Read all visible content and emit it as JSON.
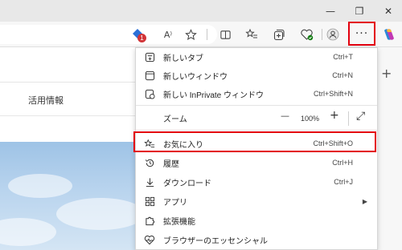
{
  "window": {
    "minimize_glyph": "—",
    "restore_glyph": "❐",
    "close_glyph": "✕"
  },
  "toolbar": {
    "read_aloud_glyph": "A⁾",
    "more_glyph": "···"
  },
  "page": {
    "nav_text": "活用情報"
  },
  "sidebar": {
    "add_glyph": "+"
  },
  "menu": {
    "new_tab": {
      "label": "新しいタブ",
      "shortcut": "Ctrl+T",
      "icon": "new-tab-icon"
    },
    "new_window": {
      "label": "新しいウィンドウ",
      "shortcut": "Ctrl+N",
      "icon": "new-window-icon"
    },
    "new_inprivate": {
      "label": "新しい InPrivate ウィンドウ",
      "shortcut": "Ctrl+Shift+N",
      "icon": "inprivate-icon"
    },
    "zoom": {
      "label": "ズーム",
      "value": "100%",
      "minus": "—",
      "plus": "+",
      "expand": "⤢"
    },
    "favorites": {
      "label": "お気に入り",
      "shortcut": "Ctrl+Shift+O",
      "icon": "favorites-icon"
    },
    "history": {
      "label": "履歴",
      "shortcut": "Ctrl+H",
      "icon": "history-icon"
    },
    "downloads": {
      "label": "ダウンロード",
      "shortcut": "Ctrl+J",
      "icon": "download-icon"
    },
    "apps": {
      "label": "アプリ",
      "arrow": "▶",
      "icon": "apps-icon"
    },
    "extensions": {
      "label": "拡張機能",
      "icon": "extensions-icon"
    },
    "browser_essentials": {
      "label": "ブラウザーのエッセンシャル",
      "icon": "heart-pulse-icon"
    }
  },
  "colors": {
    "highlight": "#e3000f",
    "badge": "#d13438"
  }
}
